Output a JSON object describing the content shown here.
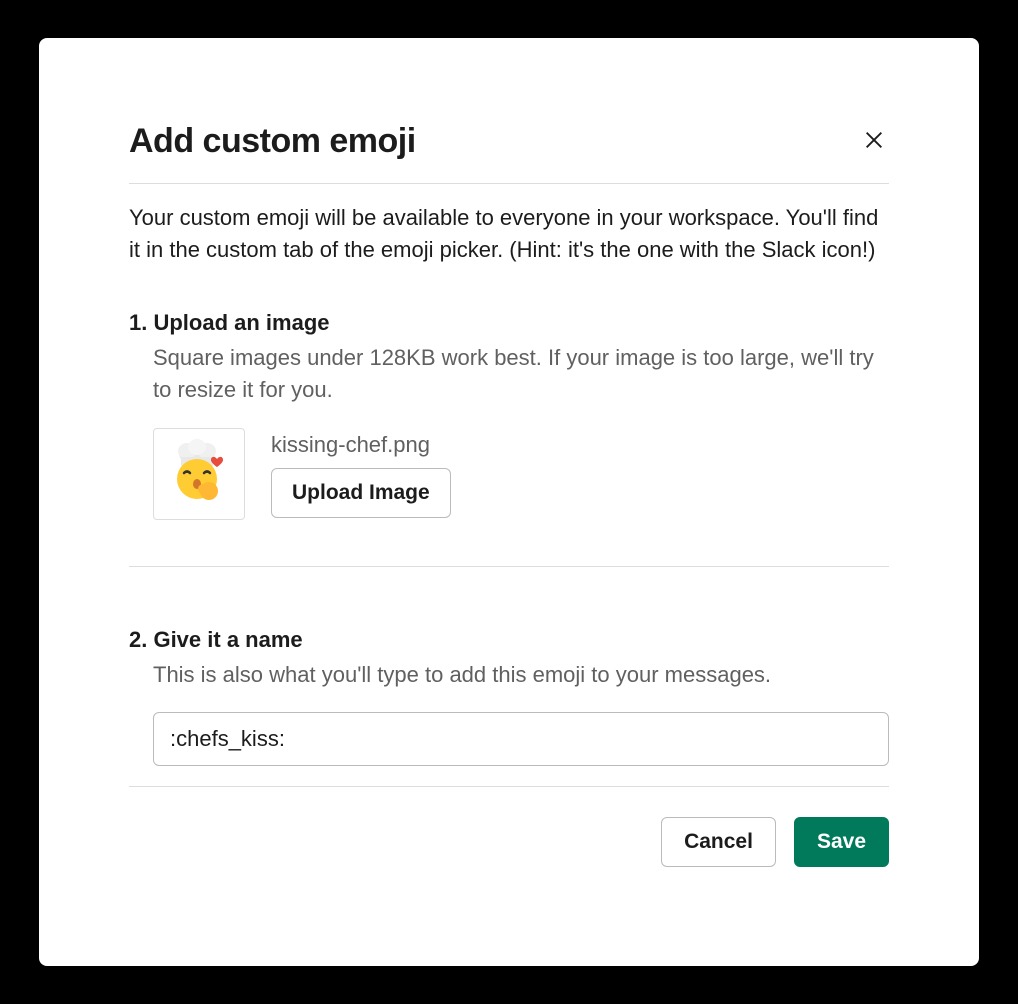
{
  "modal": {
    "title": "Add custom emoji",
    "intro": "Your custom emoji will be available to everyone in your workspace. You'll find it in the custom tab of the emoji picker. (Hint: it's the one with the Slack icon!)"
  },
  "upload": {
    "title": "1. Upload an image",
    "desc": "Square images under 128KB work best. If your image is too large, we'll try to resize it for you.",
    "filename": "kissing-chef.png",
    "button": "Upload Image"
  },
  "name": {
    "title": "2. Give it a name",
    "desc": "This is also what you'll type to add this emoji to your messages.",
    "value": ":chefs_kiss:"
  },
  "footer": {
    "cancel": "Cancel",
    "save": "Save"
  }
}
